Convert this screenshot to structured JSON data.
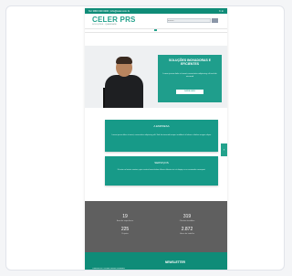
{
  "topbar": {
    "left_text": "Tel: 0800 000 0000   |   info@celer.com.br",
    "right_text": "f  t  in"
  },
  "brand": {
    "logo": "CELER PRS",
    "tagline": "SOLUÇÕES · QUALIDADE"
  },
  "search": {
    "placeholder": "Buscar..."
  },
  "hero": {
    "title": "SOLUÇÕES INOVADORAS E EFICIENTES",
    "text": "Lorem ipsum dolor sit amet consectetur adipiscing elit sed do eiusmod",
    "button": "SAIBA MAIS"
  },
  "boxes": [
    {
      "heading": "A EMPRESA",
      "body": "Lorem ipsum dolor sit amet, consectetur adipiscing elit. Sed do eiusmod tempor incididunt ut labore et dolore magna aliqua."
    },
    {
      "heading": "SERVIÇOS",
      "body": "Ut enim ad minim veniam, quis nostrud exercitation ullamco laboris nisi ut aliquip ex ea commodo consequat."
    }
  ],
  "stats": [
    {
      "value": "19",
      "label": "Anos de experiência"
    },
    {
      "value": "319",
      "label": "Clientes atendidos"
    },
    {
      "value": "225",
      "label": "Projetos"
    },
    {
      "value": "2.872",
      "label": "Horas de trabalho"
    }
  ],
  "footer": {
    "title": "NEWSLETTER",
    "note": "Cadastre-se e receba nossas novidades"
  },
  "colors": {
    "brand_teal": "#179a88",
    "stats_gray": "#5f5f5f"
  }
}
